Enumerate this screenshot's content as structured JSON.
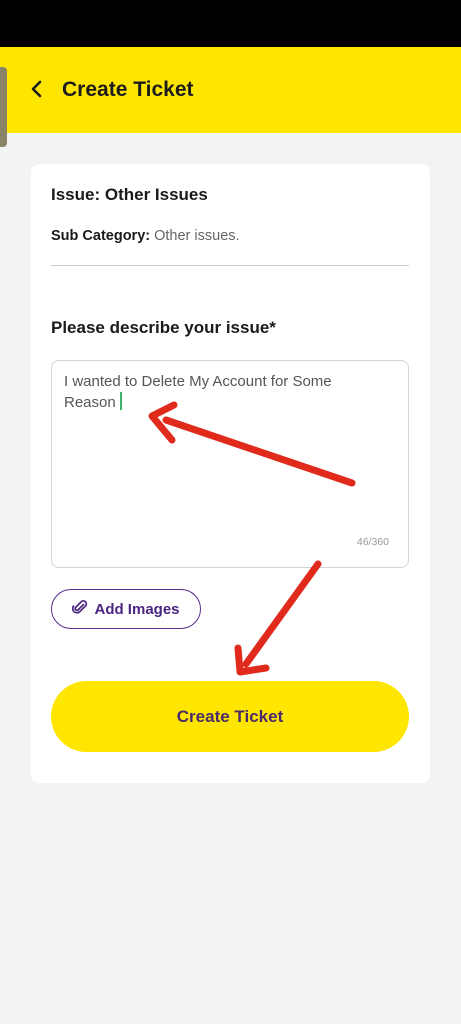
{
  "header": {
    "title": "Create Ticket",
    "back_icon": "chevron-left-icon"
  },
  "issue": {
    "title": "Issue: Other Issues",
    "sub_category_label": "Sub Category:",
    "sub_category_value": "Other issues."
  },
  "description": {
    "label": "Please describe your issue*",
    "value": "I wanted to Delete My Account for Some Reason",
    "counter": "46/360"
  },
  "add_images": {
    "label": "Add Images",
    "icon": "paperclip-icon"
  },
  "submit": {
    "label": "Create Ticket"
  },
  "colors": {
    "accent_yellow": "#ffe600",
    "purple": "#4b2580",
    "annotation_red": "#e02a1b"
  }
}
